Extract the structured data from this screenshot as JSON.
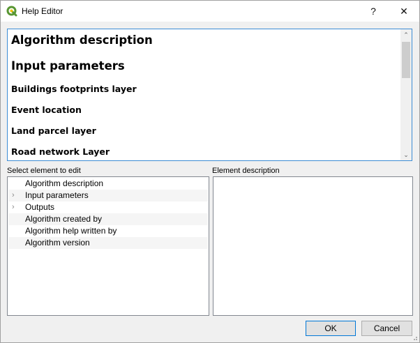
{
  "window": {
    "title": "Help Editor",
    "help_label": "?",
    "close_label": "✕"
  },
  "preview": {
    "headings": [
      {
        "text": "Algorithm description",
        "size": "large"
      },
      {
        "text": "Input parameters",
        "size": "large"
      },
      {
        "text": "Buildings footprints layer",
        "size": "small"
      },
      {
        "text": "Event location",
        "size": "small"
      },
      {
        "text": "Land parcel layer",
        "size": "small"
      },
      {
        "text": "Road network Layer",
        "size": "small"
      }
    ],
    "scroll_up": "⌃",
    "scroll_down": "⌄"
  },
  "tree": {
    "label": "Select element to edit",
    "items": [
      {
        "label": "Algorithm description",
        "expandable": false
      },
      {
        "label": "Input parameters",
        "expandable": true
      },
      {
        "label": "Outputs",
        "expandable": true
      },
      {
        "label": "Algorithm created by",
        "expandable": false
      },
      {
        "label": "Algorithm help written by",
        "expandable": false
      },
      {
        "label": "Algorithm version",
        "expandable": false
      }
    ]
  },
  "description": {
    "label": "Element description",
    "value": ""
  },
  "buttons": {
    "ok": "OK",
    "cancel": "Cancel"
  },
  "colors": {
    "accent": "#3c8cd4",
    "qgis_green": "#589632"
  }
}
